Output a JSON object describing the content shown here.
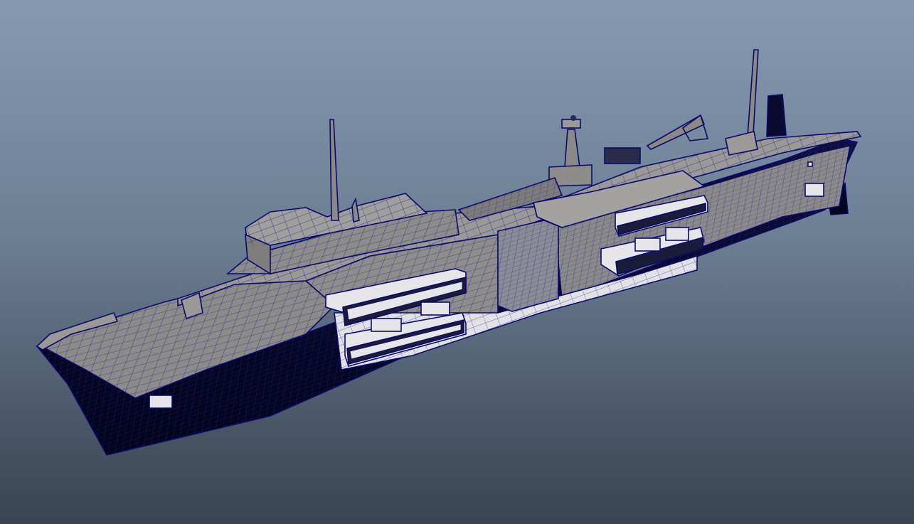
{
  "viewport": {
    "background_top": "#8799b0",
    "background_bottom": "#3a4452",
    "wireframe_color": "#1a1a8c",
    "hull_dark_color": "#05051e",
    "deck_gray_color": "#8f8e8c",
    "highlight_color": "#e6e6ea"
  },
  "model": {
    "shading": "wireframe-on-shaded",
    "selected": true
  }
}
